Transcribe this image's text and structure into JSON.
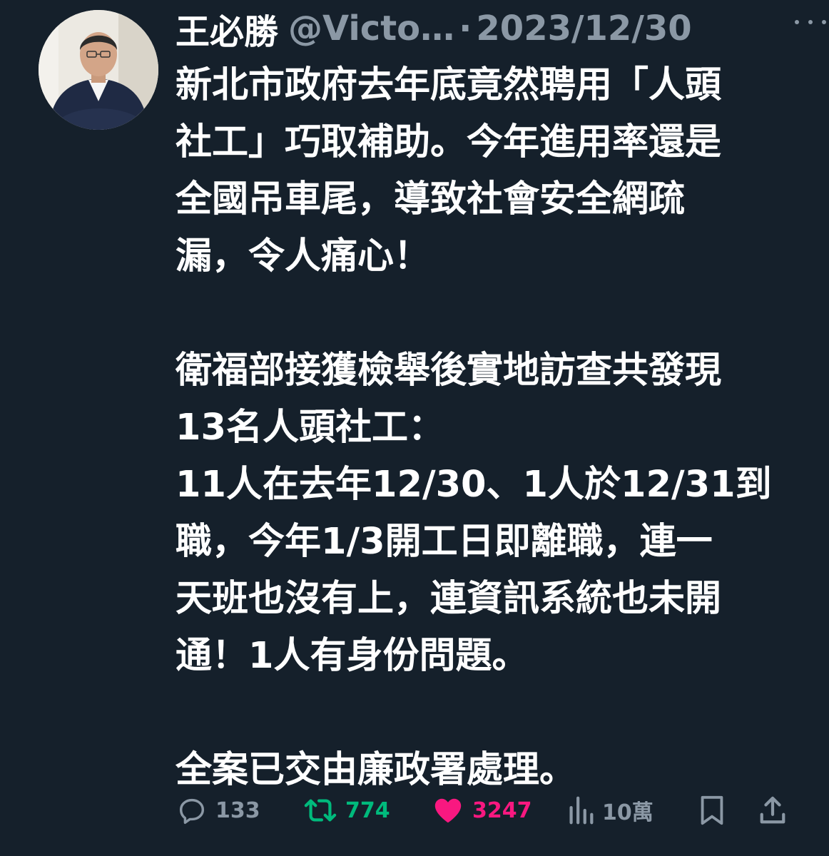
{
  "author": {
    "name": "王必勝",
    "handle": "@Victo…",
    "separator": "·",
    "date": "2023/12/30"
  },
  "tweet": {
    "paragraphs": [
      "新北市政府去年底竟然聘用「人頭\n社工」巧取補助。今年進用率還是\n全國吊車尾，導致社會安全網疏\n漏，令人痛心！",
      "衛福部接獲檢舉後實地訪查共發現\n13名人頭社工：\n11人在去年12/30、1人於12/31到\n職，今年1/3開工日即離職，連一\n天班也沒有上，連資訊系統也未開\n通！1人有身份問題。",
      "全案已交由廉政署處理。"
    ]
  },
  "actions": {
    "reply_count": "133",
    "retweet_count": "774",
    "like_count": "3247",
    "views_count": "10萬"
  },
  "icons": {
    "reply": "reply-icon",
    "retweet": "retweet-icon",
    "like": "heart-icon",
    "views": "views-icon",
    "bookmark": "bookmark-icon",
    "share": "share-icon",
    "more": "more-icon"
  },
  "colors": {
    "background": "#15202b",
    "muted": "#8b98a5",
    "retweet": "#00ba7c",
    "like": "#f91880",
    "text": "#ffffff"
  }
}
